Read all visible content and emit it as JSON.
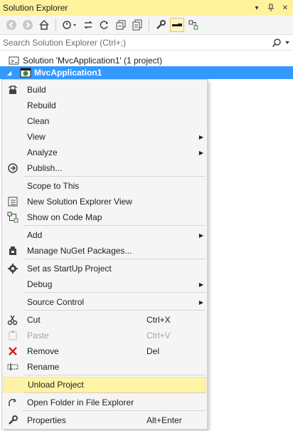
{
  "window": {
    "title": "Solution Explorer",
    "pin_glyph": "▾",
    "unpin_glyph": "⊥",
    "close_glyph": "✕"
  },
  "toolbar": {
    "buttons": [
      {
        "icon": "back-icon"
      },
      {
        "icon": "forward-icon"
      },
      {
        "icon": "home-icon"
      },
      {
        "icon": "pending-changes-filter-icon"
      },
      {
        "icon": "sync-icon"
      },
      {
        "icon": "refresh-icon"
      },
      {
        "icon": "collapse-all-icon"
      },
      {
        "icon": "show-all-files-icon"
      },
      {
        "icon": "properties-icon"
      },
      {
        "icon": "preview-selected-items-icon"
      },
      {
        "icon": "class-view-icon"
      }
    ]
  },
  "search": {
    "placeholder": "Search Solution Explorer (Ctrl+;)"
  },
  "tree": {
    "solution_label": "Solution 'MvcApplication1' (1 project)",
    "project_label": "MvcApplication1"
  },
  "menu": {
    "items": [
      {
        "label": "Build",
        "shortcut": "",
        "icon": "build-icon"
      },
      {
        "label": "Rebuild",
        "shortcut": "",
        "icon": ""
      },
      {
        "label": "Clean",
        "shortcut": "",
        "icon": ""
      },
      {
        "label": "View",
        "shortcut": "",
        "icon": "",
        "submenu": true
      },
      {
        "label": "Analyze",
        "shortcut": "",
        "icon": "",
        "submenu": true
      },
      {
        "label": "Publish...",
        "shortcut": "",
        "icon": "publish-icon"
      },
      {
        "label": "Scope to This",
        "shortcut": "",
        "icon": ""
      },
      {
        "label": "New Solution Explorer View",
        "shortcut": "",
        "icon": "new-view-icon"
      },
      {
        "label": "Show on Code Map",
        "shortcut": "",
        "icon": "code-map-icon"
      },
      {
        "label": "Add",
        "shortcut": "",
        "icon": "",
        "submenu": true
      },
      {
        "label": "Manage NuGet Packages...",
        "shortcut": "",
        "icon": "nuget-icon"
      },
      {
        "label": "Set as StartUp Project",
        "shortcut": "",
        "icon": "gear-icon"
      },
      {
        "label": "Debug",
        "shortcut": "",
        "icon": "",
        "submenu": true
      },
      {
        "label": "Source Control",
        "shortcut": "",
        "icon": "",
        "submenu": true
      },
      {
        "label": "Cut",
        "shortcut": "Ctrl+X",
        "icon": "cut-icon"
      },
      {
        "label": "Paste",
        "shortcut": "Ctrl+V",
        "icon": "paste-icon",
        "disabled": true
      },
      {
        "label": "Remove",
        "shortcut": "Del",
        "icon": "remove-icon"
      },
      {
        "label": "Rename",
        "shortcut": "",
        "icon": "rename-icon"
      },
      {
        "label": "Unload Project",
        "shortcut": "",
        "icon": "",
        "hover": true
      },
      {
        "label": "Open Folder in File Explorer",
        "shortcut": "",
        "icon": "open-folder-icon"
      },
      {
        "label": "Properties",
        "shortcut": "Alt+Enter",
        "icon": "wrench-icon"
      }
    ],
    "submenu_arrow": "▶"
  },
  "colors": {
    "titlebar_bg": "#fff29d",
    "selection_bg": "#3399ff",
    "menu_hover_bg": "#fff3a6",
    "disabled_text": "#a2a4a5"
  }
}
